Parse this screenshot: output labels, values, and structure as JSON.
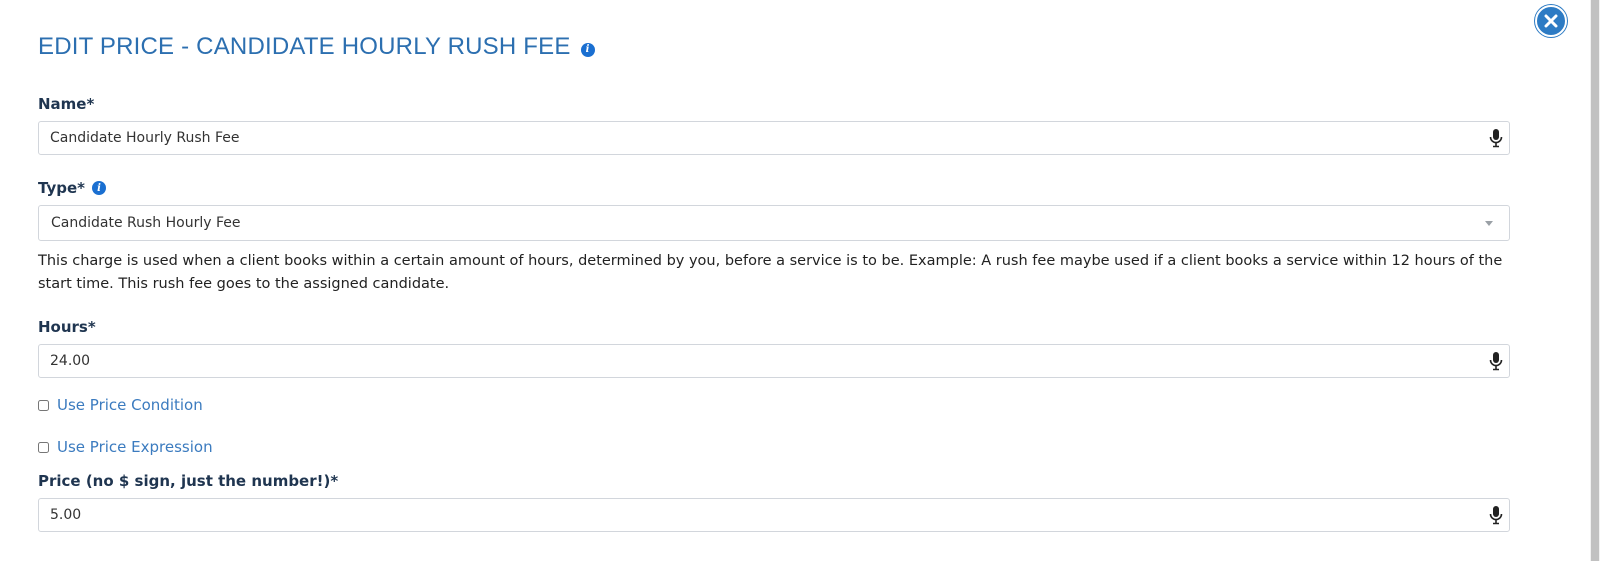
{
  "dialog": {
    "title": "EDIT PRICE - CANDIDATE HOURLY RUSH FEE",
    "accent_color": "#2c6fb0"
  },
  "fields": {
    "name": {
      "label": "Name*",
      "value": "Candidate Hourly Rush Fee"
    },
    "type": {
      "label": "Type*",
      "selected": "Candidate Rush Hourly Fee",
      "description": "This charge is used when a client books within a certain amount of hours, determined by you, before a service is to be. Example: A rush fee maybe used if a client books a service within 12 hours of the start time. This rush fee goes to the assigned candidate."
    },
    "hours": {
      "label": "Hours*",
      "value": "24.00"
    },
    "use_price_condition": {
      "label": "Use Price Condition",
      "checked": false
    },
    "use_price_expression": {
      "label": "Use Price Expression",
      "checked": false
    },
    "price": {
      "label": "Price (no $ sign, just the number!)*",
      "value": "5.00"
    }
  },
  "icons": {
    "close": "close-icon",
    "info": "info-icon",
    "mic": "microphone-icon",
    "dropdown": "chevron-down-icon"
  }
}
